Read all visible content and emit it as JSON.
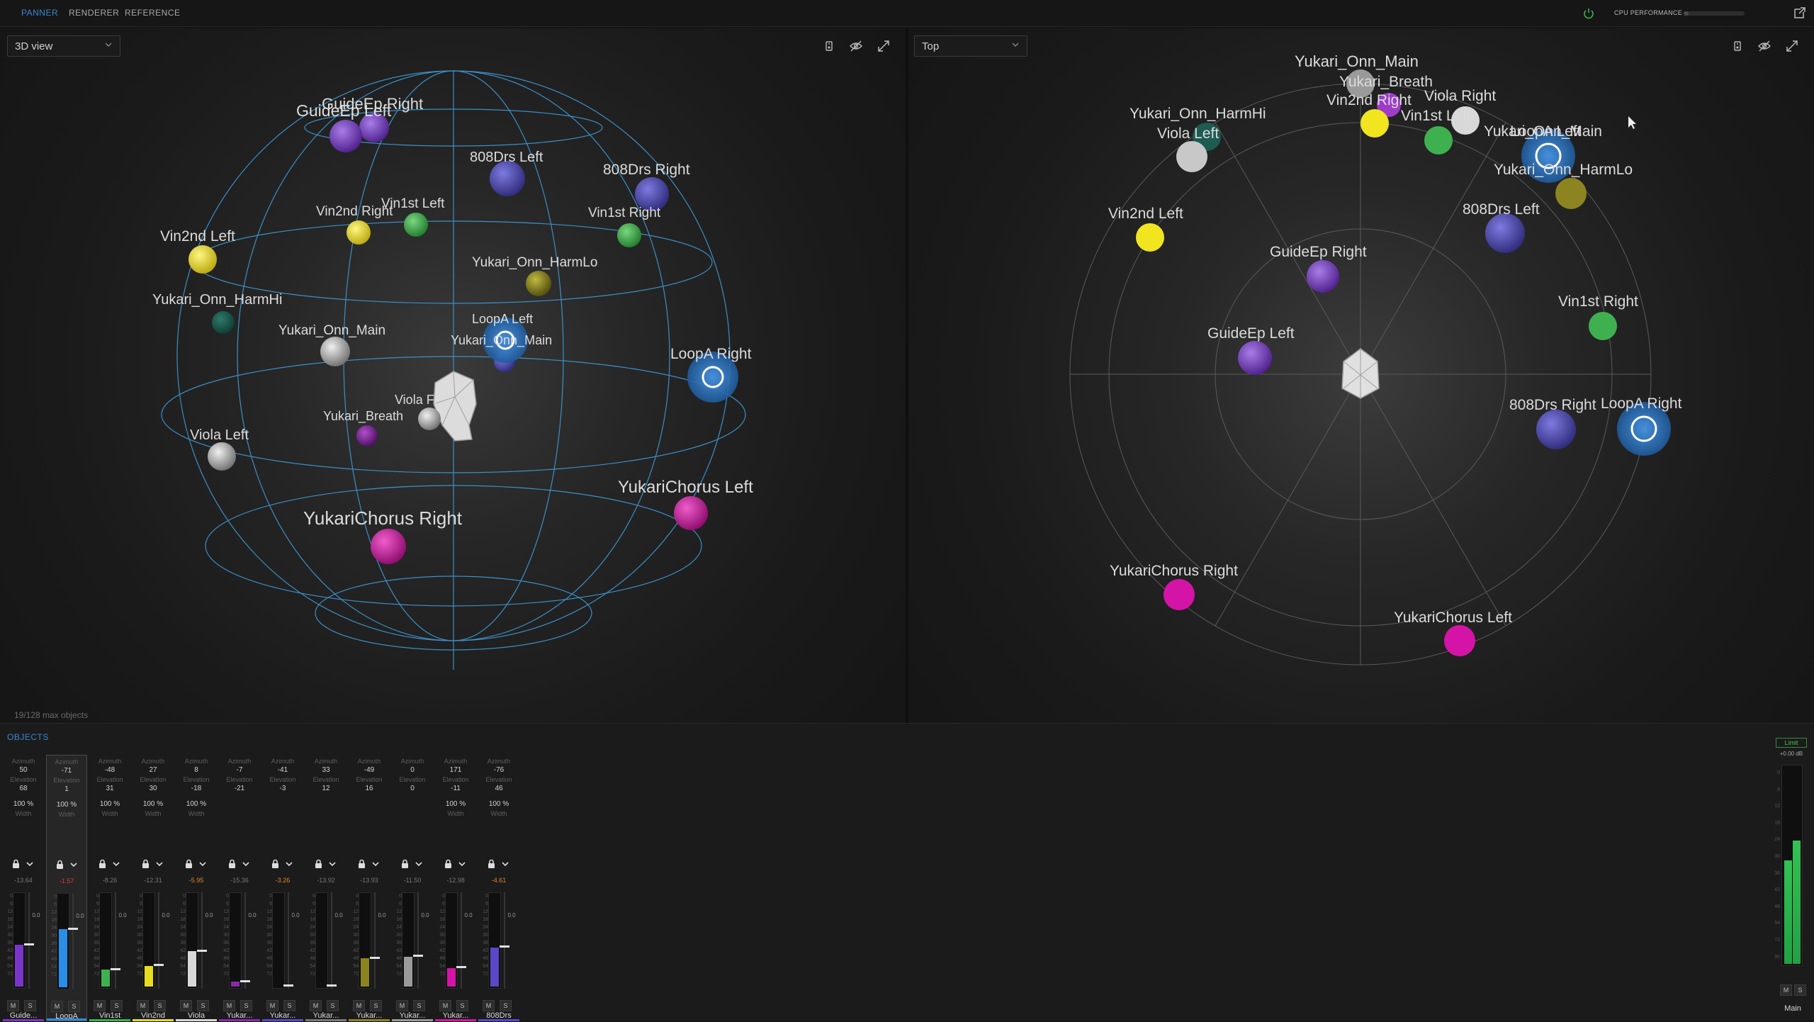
{
  "tabs": [
    {
      "label": "PANNER",
      "active": true
    },
    {
      "label": "RENDERER",
      "active": false
    },
    {
      "label": "REFERENCE",
      "active": false
    }
  ],
  "cpu": {
    "label": "CPU PERFORMANCE",
    "level": 0.08
  },
  "left_view": {
    "selector": "3D view",
    "object_count": "19/128 max objects"
  },
  "right_view": {
    "selector": "Top"
  },
  "colors": {
    "accent": "#3a86d4",
    "purple": "#7a36c8",
    "blue": "#2b8ee6",
    "green": "#3fb04f",
    "yellow": "#e8dc22",
    "gray": "#b4b4b4",
    "teal": "#1e5b50",
    "olive": "#8c8420",
    "magenta": "#d414a6",
    "indigo": "#5848c8",
    "violet": "#8a2aa8"
  },
  "scene3d": {
    "labels": [
      {
        "text": "GuideEp Right"
      },
      {
        "text": "GuideEp Left"
      },
      {
        "text": "808Drs Left"
      },
      {
        "text": "808Drs Right"
      },
      {
        "text": "Vin2nd Right"
      },
      {
        "text": "Vin1st Left"
      },
      {
        "text": "Vin1st Right"
      },
      {
        "text": "Vin2nd Left"
      },
      {
        "text": "Yukari_Onn_HarmLo"
      },
      {
        "text": "Yukari_Onn_HarmHi"
      },
      {
        "text": "Yukari_Onn_Main"
      },
      {
        "text": "LoopA Left"
      },
      {
        "text": "Yukari_Onn_Main"
      },
      {
        "text": "LoopA Right"
      },
      {
        "text": "Viola Fr"
      },
      {
        "text": "Yukari_Breath"
      },
      {
        "text": "Viola Left"
      },
      {
        "text": "YukariChorus Right"
      },
      {
        "text": "YukariChorus Left"
      }
    ]
  },
  "scene_top": {
    "labels": [
      {
        "text": "Yukari_Onn_Main"
      },
      {
        "text": "Yukari_Breath"
      },
      {
        "text": "Vin2nd Right"
      },
      {
        "text": "Viola Right"
      },
      {
        "text": "Vin1st Left"
      },
      {
        "text": "LoopA Left"
      },
      {
        "text": "Yukari_Onn_Main"
      },
      {
        "text": "Yukari_Onn_HarmHi"
      },
      {
        "text": "Viola Left"
      },
      {
        "text": "Yukari_Onn_HarmLo"
      },
      {
        "text": "Vin2nd Left"
      },
      {
        "text": "808Drs Left"
      },
      {
        "text": "GuideEp Right"
      },
      {
        "text": "Vin1st Right"
      },
      {
        "text": "GuideEp Left"
      },
      {
        "text": "808Drs Right"
      },
      {
        "text": "LoopA Right"
      },
      {
        "text": "YukariChorus Right"
      },
      {
        "text": "YukariChorus Left"
      }
    ]
  },
  "objects_panel": {
    "title": "OBJECTS",
    "captions": {
      "azimuth": "Azimuth",
      "elevation": "Elevation",
      "width": "Width",
      "mute": "M",
      "solo": "S"
    },
    "ticks": [
      "0",
      "6",
      "12",
      "18",
      "24",
      "30",
      "36",
      "42",
      "48",
      "54",
      "72"
    ],
    "strips": [
      {
        "name": "Guide...",
        "az": "50",
        "el": "68",
        "width": "100 %",
        "db": "-13.64",
        "db_state": "normal",
        "gain": "0.0",
        "level": 0.45,
        "color": "#7a36c8"
      },
      {
        "name": "LoopA",
        "az": "-71",
        "el": "1",
        "width": "100 %",
        "db": "-1.57",
        "db_state": "clip",
        "gain": "0.0",
        "level": 0.62,
        "color": "#2b8ee6"
      },
      {
        "name": "Vin1st",
        "az": "-48",
        "el": "31",
        "width": "100 %",
        "db": "-8.26",
        "db_state": "normal",
        "gain": "0.0",
        "level": 0.18,
        "color": "#3fb04f"
      },
      {
        "name": "Vin2nd",
        "az": "27",
        "el": "30",
        "width": "100 %",
        "db": "-12.31",
        "db_state": "normal",
        "gain": "0.0",
        "level": 0.22,
        "color": "#e8dc22"
      },
      {
        "name": "Viola",
        "az": "8",
        "el": "-18",
        "width": "100 %",
        "db": "-5.95",
        "db_state": "peak",
        "gain": "0.0",
        "level": 0.38,
        "color": "#d8d8d8"
      },
      {
        "name": "Yukar...",
        "az": "-7",
        "el": "-21",
        "width": "",
        "db": "-15.36",
        "db_state": "normal",
        "gain": "0.0",
        "level": 0.05,
        "color": "#8a2aa8"
      },
      {
        "name": "Yukar...",
        "az": "-41",
        "el": "-3",
        "width": "",
        "db": "-3.26",
        "db_state": "peak",
        "gain": "0.0",
        "level": 0.0,
        "color": "#5848c8"
      },
      {
        "name": "Yukar...",
        "az": "33",
        "el": "12",
        "width": "",
        "db": "-13.92",
        "db_state": "normal",
        "gain": "0.0",
        "level": 0.0,
        "color": "#7a7a7a"
      },
      {
        "name": "Yukar...",
        "az": "-49",
        "el": "16",
        "width": "",
        "db": "-13.93",
        "db_state": "normal",
        "gain": "0.0",
        "level": 0.3,
        "color": "#8c8420"
      },
      {
        "name": "Yukar...",
        "az": "0",
        "el": "0",
        "width": "",
        "db": "-11.50",
        "db_state": "normal",
        "gain": "0.0",
        "level": 0.32,
        "color": "#9a9a9a"
      },
      {
        "name": "Yukar...",
        "az": "171",
        "el": "-11",
        "width": "100 %",
        "db": "-12.98",
        "db_state": "normal",
        "gain": "0.0",
        "level": 0.2,
        "color": "#d414a6"
      },
      {
        "name": "808Drs",
        "az": "-76",
        "el": "46",
        "width": "100 %",
        "db": "-4.61",
        "db_state": "peak",
        "gain": "0.0",
        "level": 0.42,
        "color": "#5848c8"
      }
    ]
  },
  "master": {
    "limit_label": "Limit",
    "db": "+0.00 dB",
    "name": "Main",
    "level_l": 0.52,
    "level_r": 0.62,
    "ticks": [
      "0",
      "6",
      "12",
      "18",
      "24",
      "30",
      "36",
      "42",
      "48",
      "54",
      "72",
      "90"
    ]
  }
}
